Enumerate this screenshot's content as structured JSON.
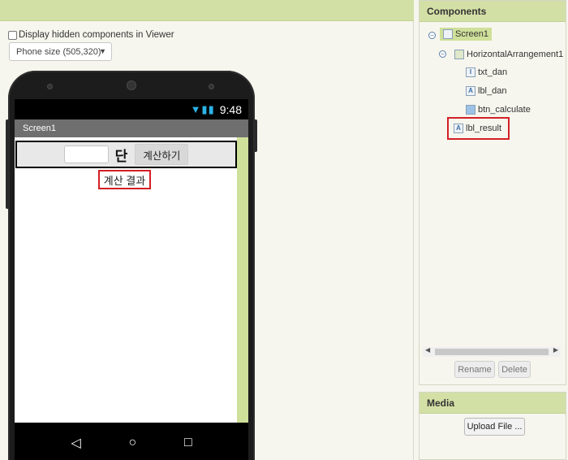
{
  "viewer": {
    "show_hidden_label": "Display hidden components in Viewer",
    "size_select": "Phone size (505,320)"
  },
  "phone": {
    "time": "9:48",
    "screen_title": "Screen1",
    "dan_label": "단",
    "calc_button": "계산하기",
    "result_label": "계산 결과"
  },
  "components": {
    "title": "Components",
    "tree": [
      {
        "name": "Screen1"
      },
      {
        "name": "HorizontalArrangement1"
      },
      {
        "name": "txt_dan"
      },
      {
        "name": "lbl_dan"
      },
      {
        "name": "btn_calculate"
      },
      {
        "name": "lbl_result"
      }
    ],
    "rename_button": "Rename",
    "delete_button": "Delete"
  },
  "media": {
    "title": "Media",
    "upload_button": "Upload File ..."
  }
}
